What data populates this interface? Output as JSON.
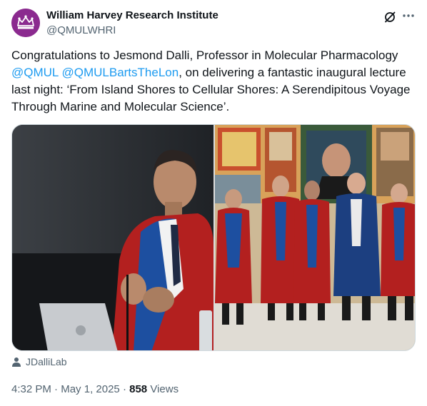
{
  "author": {
    "display_name": "William Harvey Research Institute",
    "handle": "@QMULWHRI",
    "avatar_icon": "crown-logo-icon",
    "avatar_color": "#8b2a8f"
  },
  "header_icons": [
    "grok-icon",
    "more-icon"
  ],
  "tweet": {
    "text_part1": "Congratulations to Jesmond Dalli, Professor in Molecular Pharmacology ",
    "mention1": "@QMUL",
    "text_space": " ",
    "mention2": "@QMULBartsTheLon",
    "text_part2": ", on delivering a fantastic inaugural lecture last night: ‘From Island Shores to Cellular Shores: A Serendipitous Voyage Through Marine and Molecular Science’."
  },
  "media": {
    "photo_left": "lecture-photo",
    "photo_right": "group-photo"
  },
  "photo_credit": {
    "icon": "person-icon",
    "text": "JDalliLab"
  },
  "meta": {
    "time": "4:32 PM",
    "separator": " · ",
    "date": "May 1, 2025",
    "views_count": "858",
    "views_label": " Views"
  },
  "colors": {
    "text": "#0f1419",
    "secondary": "#536471",
    "link": "#1d9bf0"
  }
}
